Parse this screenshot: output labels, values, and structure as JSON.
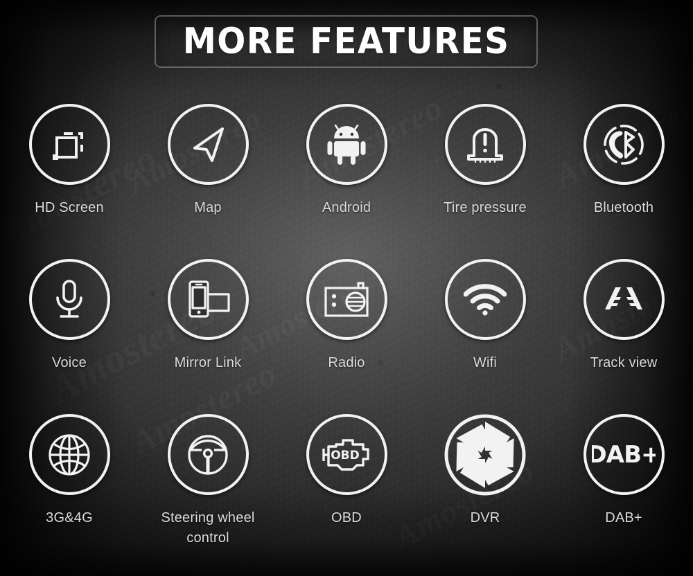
{
  "header": {
    "title": "MORE FEATURES"
  },
  "watermark": {
    "text": "Amostereo"
  },
  "colors": {
    "background": "#3a3a3a",
    "icon_stroke": "#f2f2f2",
    "label_text": "#dcdcdc",
    "title_text": "#ffffff",
    "title_border": "#969696"
  },
  "features": [
    {
      "label": "HD Screen",
      "icon": "hd-screen-icon"
    },
    {
      "label": "Map",
      "icon": "navigation-arrow-icon"
    },
    {
      "label": "Android",
      "icon": "android-robot-icon"
    },
    {
      "label": "Tire pressure",
      "icon": "tire-pressure-icon"
    },
    {
      "label": "Bluetooth",
      "icon": "bluetooth-phone-icon"
    },
    {
      "label": "Voice",
      "icon": "microphone-icon"
    },
    {
      "label": "Mirror Link",
      "icon": "mirror-link-icon"
    },
    {
      "label": "Radio",
      "icon": "radio-icon"
    },
    {
      "label": "Wifi",
      "icon": "wifi-icon"
    },
    {
      "label": "Track view",
      "icon": "track-view-icon"
    },
    {
      "label": "3G&4G",
      "icon": "globe-icon"
    },
    {
      "label": "Steering wheel control",
      "icon": "steering-wheel-icon"
    },
    {
      "label": "OBD",
      "icon": "obd-engine-icon"
    },
    {
      "label": "DVR",
      "icon": "camera-aperture-icon"
    },
    {
      "label": "DAB+",
      "icon": "dab-plus-icon"
    }
  ],
  "icon_text": {
    "obd": "OBD",
    "dab": "DAB+"
  }
}
